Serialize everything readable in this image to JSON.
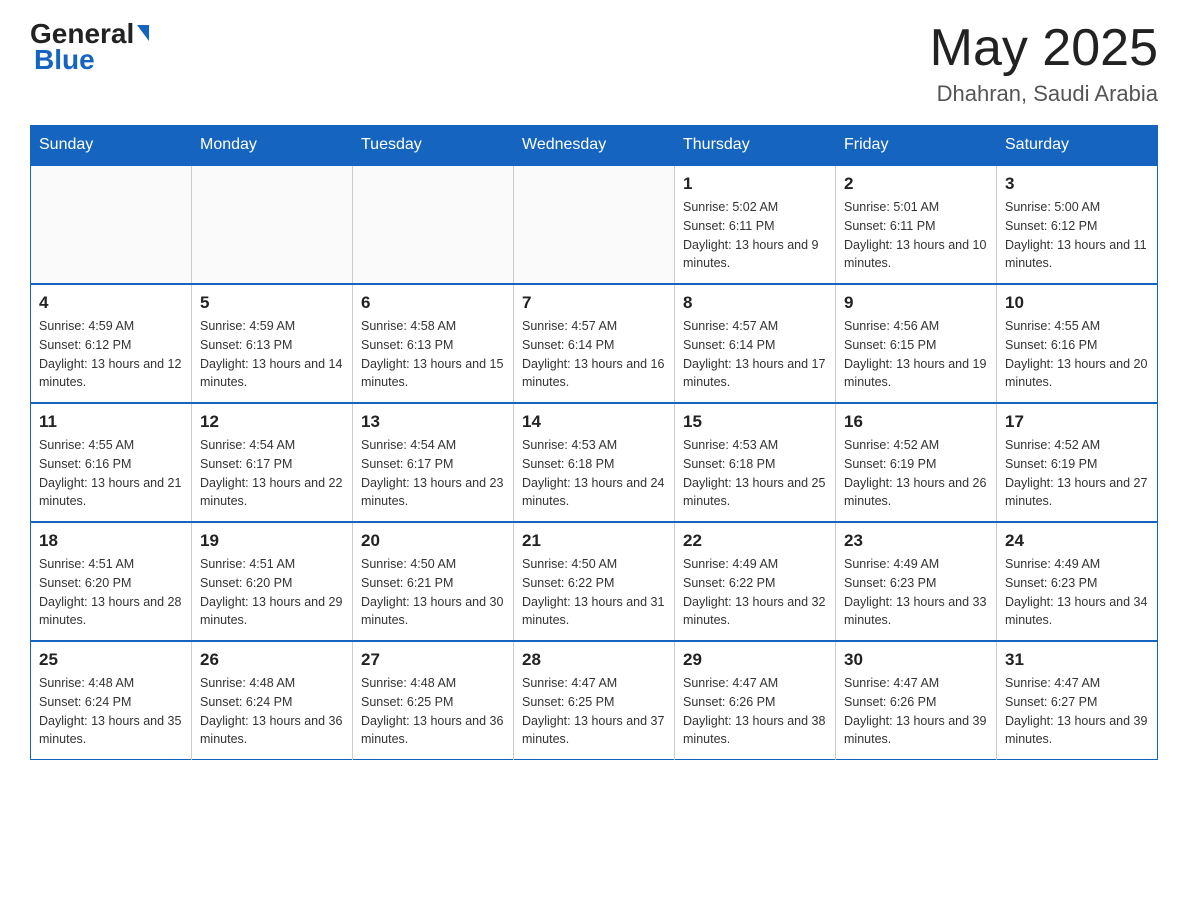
{
  "header": {
    "logo_general": "General",
    "logo_blue": "Blue",
    "month_title": "May 2025",
    "location": "Dhahran, Saudi Arabia"
  },
  "days_of_week": [
    "Sunday",
    "Monday",
    "Tuesday",
    "Wednesday",
    "Thursday",
    "Friday",
    "Saturday"
  ],
  "weeks": [
    [
      {
        "day": "",
        "info": ""
      },
      {
        "day": "",
        "info": ""
      },
      {
        "day": "",
        "info": ""
      },
      {
        "day": "",
        "info": ""
      },
      {
        "day": "1",
        "info": "Sunrise: 5:02 AM\nSunset: 6:11 PM\nDaylight: 13 hours and 9 minutes."
      },
      {
        "day": "2",
        "info": "Sunrise: 5:01 AM\nSunset: 6:11 PM\nDaylight: 13 hours and 10 minutes."
      },
      {
        "day": "3",
        "info": "Sunrise: 5:00 AM\nSunset: 6:12 PM\nDaylight: 13 hours and 11 minutes."
      }
    ],
    [
      {
        "day": "4",
        "info": "Sunrise: 4:59 AM\nSunset: 6:12 PM\nDaylight: 13 hours and 12 minutes."
      },
      {
        "day": "5",
        "info": "Sunrise: 4:59 AM\nSunset: 6:13 PM\nDaylight: 13 hours and 14 minutes."
      },
      {
        "day": "6",
        "info": "Sunrise: 4:58 AM\nSunset: 6:13 PM\nDaylight: 13 hours and 15 minutes."
      },
      {
        "day": "7",
        "info": "Sunrise: 4:57 AM\nSunset: 6:14 PM\nDaylight: 13 hours and 16 minutes."
      },
      {
        "day": "8",
        "info": "Sunrise: 4:57 AM\nSunset: 6:14 PM\nDaylight: 13 hours and 17 minutes."
      },
      {
        "day": "9",
        "info": "Sunrise: 4:56 AM\nSunset: 6:15 PM\nDaylight: 13 hours and 19 minutes."
      },
      {
        "day": "10",
        "info": "Sunrise: 4:55 AM\nSunset: 6:16 PM\nDaylight: 13 hours and 20 minutes."
      }
    ],
    [
      {
        "day": "11",
        "info": "Sunrise: 4:55 AM\nSunset: 6:16 PM\nDaylight: 13 hours and 21 minutes."
      },
      {
        "day": "12",
        "info": "Sunrise: 4:54 AM\nSunset: 6:17 PM\nDaylight: 13 hours and 22 minutes."
      },
      {
        "day": "13",
        "info": "Sunrise: 4:54 AM\nSunset: 6:17 PM\nDaylight: 13 hours and 23 minutes."
      },
      {
        "day": "14",
        "info": "Sunrise: 4:53 AM\nSunset: 6:18 PM\nDaylight: 13 hours and 24 minutes."
      },
      {
        "day": "15",
        "info": "Sunrise: 4:53 AM\nSunset: 6:18 PM\nDaylight: 13 hours and 25 minutes."
      },
      {
        "day": "16",
        "info": "Sunrise: 4:52 AM\nSunset: 6:19 PM\nDaylight: 13 hours and 26 minutes."
      },
      {
        "day": "17",
        "info": "Sunrise: 4:52 AM\nSunset: 6:19 PM\nDaylight: 13 hours and 27 minutes."
      }
    ],
    [
      {
        "day": "18",
        "info": "Sunrise: 4:51 AM\nSunset: 6:20 PM\nDaylight: 13 hours and 28 minutes."
      },
      {
        "day": "19",
        "info": "Sunrise: 4:51 AM\nSunset: 6:20 PM\nDaylight: 13 hours and 29 minutes."
      },
      {
        "day": "20",
        "info": "Sunrise: 4:50 AM\nSunset: 6:21 PM\nDaylight: 13 hours and 30 minutes."
      },
      {
        "day": "21",
        "info": "Sunrise: 4:50 AM\nSunset: 6:22 PM\nDaylight: 13 hours and 31 minutes."
      },
      {
        "day": "22",
        "info": "Sunrise: 4:49 AM\nSunset: 6:22 PM\nDaylight: 13 hours and 32 minutes."
      },
      {
        "day": "23",
        "info": "Sunrise: 4:49 AM\nSunset: 6:23 PM\nDaylight: 13 hours and 33 minutes."
      },
      {
        "day": "24",
        "info": "Sunrise: 4:49 AM\nSunset: 6:23 PM\nDaylight: 13 hours and 34 minutes."
      }
    ],
    [
      {
        "day": "25",
        "info": "Sunrise: 4:48 AM\nSunset: 6:24 PM\nDaylight: 13 hours and 35 minutes."
      },
      {
        "day": "26",
        "info": "Sunrise: 4:48 AM\nSunset: 6:24 PM\nDaylight: 13 hours and 36 minutes."
      },
      {
        "day": "27",
        "info": "Sunrise: 4:48 AM\nSunset: 6:25 PM\nDaylight: 13 hours and 36 minutes."
      },
      {
        "day": "28",
        "info": "Sunrise: 4:47 AM\nSunset: 6:25 PM\nDaylight: 13 hours and 37 minutes."
      },
      {
        "day": "29",
        "info": "Sunrise: 4:47 AM\nSunset: 6:26 PM\nDaylight: 13 hours and 38 minutes."
      },
      {
        "day": "30",
        "info": "Sunrise: 4:47 AM\nSunset: 6:26 PM\nDaylight: 13 hours and 39 minutes."
      },
      {
        "day": "31",
        "info": "Sunrise: 4:47 AM\nSunset: 6:27 PM\nDaylight: 13 hours and 39 minutes."
      }
    ]
  ]
}
